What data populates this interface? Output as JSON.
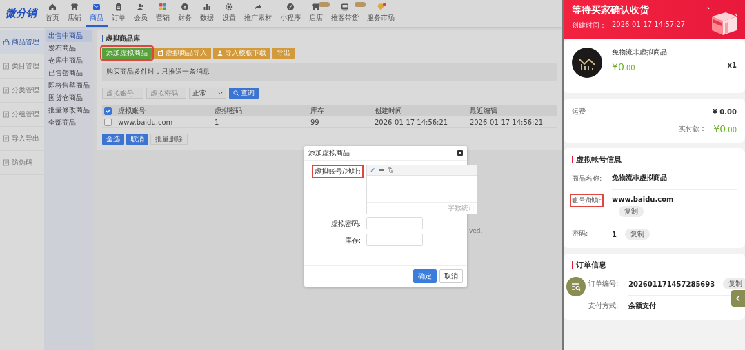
{
  "top_nav": {
    "logo": "微分销",
    "items": [
      {
        "label": "首页",
        "selected": false,
        "badge": false,
        "alert": false
      },
      {
        "label": "店铺",
        "selected": false,
        "badge": false,
        "alert": false
      },
      {
        "label": "商品",
        "selected": true,
        "badge": false,
        "alert": false
      },
      {
        "label": "订单",
        "selected": false,
        "badge": false,
        "alert": false
      },
      {
        "label": "会员",
        "selected": false,
        "badge": false,
        "alert": false
      },
      {
        "label": "营销",
        "selected": false,
        "badge": false,
        "alert": false
      },
      {
        "label": "财务",
        "selected": false,
        "badge": false,
        "alert": false
      },
      {
        "label": "数据",
        "selected": false,
        "badge": false,
        "alert": false
      },
      {
        "label": "设置",
        "selected": false,
        "badge": false,
        "alert": false
      },
      {
        "label": "推广素材",
        "selected": false,
        "badge": false,
        "alert": false
      },
      {
        "label": "小程序",
        "selected": false,
        "badge": false,
        "alert": false
      },
      {
        "label": "启店",
        "selected": false,
        "badge": true,
        "alert": false
      },
      {
        "label": "推客带货",
        "selected": false,
        "badge": true,
        "alert": false
      },
      {
        "label": "服务市场",
        "selected": false,
        "badge": false,
        "alert": true
      }
    ]
  },
  "main_menu": [
    {
      "label": "商品管理",
      "selected": true
    },
    {
      "label": "类目管理",
      "selected": false
    },
    {
      "label": "分类管理",
      "selected": false
    },
    {
      "label": "分组管理",
      "selected": false
    },
    {
      "label": "导入导出",
      "selected": false
    },
    {
      "label": "防伪码",
      "selected": false
    }
  ],
  "sub_menu": [
    {
      "label": "出售中商品",
      "selected": true
    },
    {
      "label": "发布商品",
      "selected": false
    },
    {
      "label": "仓库中商品",
      "selected": false
    },
    {
      "label": "已售罄商品",
      "selected": false
    },
    {
      "label": "即将售罄商品",
      "selected": false
    },
    {
      "label": "囤货仓商品",
      "selected": false
    },
    {
      "label": "批量修改商品",
      "selected": false
    },
    {
      "label": "全部商品",
      "selected": false
    }
  ],
  "panel": {
    "title": "虚拟商品库",
    "actions": [
      {
        "label": "添加虚拟商品",
        "kind": "primary",
        "highlighted": true
      },
      {
        "label": "虚拟商品导入",
        "kind": "import",
        "highlighted": false
      },
      {
        "label": "导入模板下载",
        "kind": "download",
        "highlighted": false
      },
      {
        "label": "导出",
        "kind": "plain",
        "highlighted": false
      }
    ],
    "notice": "购买商品多件时，只推送一条消息",
    "filters": {
      "account_placeholder": "虚拟账号",
      "password_placeholder": "虚拟密码",
      "status": "正常",
      "search_button": "查询"
    },
    "table": {
      "all_checked": true,
      "columns": [
        "虚拟账号",
        "虚拟密码",
        "库存",
        "创建时间",
        "最近编辑"
      ],
      "rows": [
        {
          "checked": false,
          "cells": [
            "www.baidu.com",
            "1",
            "99",
            "2026-01-17 14:56:21",
            "2026-01-17 14:56:21"
          ]
        }
      ]
    },
    "bulk_actions": [
      {
        "label": "全选",
        "primary": true
      },
      {
        "label": "取消",
        "primary": true
      },
      {
        "label": "批量删除",
        "primary": false
      }
    ],
    "footer_fragment": "ved."
  },
  "dialog": {
    "title": "添加虚拟商品",
    "fields": [
      {
        "label": "虚拟账号/地址:",
        "kind": "editor",
        "highlighted": true,
        "counter": "字数统计"
      },
      {
        "label": "虚拟密码:",
        "kind": "input",
        "highlighted": false
      },
      {
        "label": "库存:",
        "kind": "input",
        "highlighted": false
      }
    ],
    "buttons": [
      {
        "label": "确定",
        "primary": true
      },
      {
        "label": "取消",
        "primary": false
      }
    ]
  },
  "order_panel": {
    "status_title": "等待买家确认收货",
    "created_label": "创建时间：",
    "created_time": "2026-01-17 14:57:27",
    "product": {
      "name": "免物流非虚拟商品",
      "price": "¥0.00",
      "quantity": "x1"
    },
    "fees": {
      "shipping_label": "运费",
      "shipping": "¥ 0.00",
      "paid_label": "实付款：",
      "paid": "¥0.00"
    },
    "virtual_info": {
      "title": "虚拟帐号信息",
      "rows": [
        {
          "label": "商品名称:",
          "value": "免物流非虚拟商品",
          "kind": "text",
          "highlighted": false
        },
        {
          "label": "账号/地址",
          "value": "www.baidu.com",
          "kind": "copy_below",
          "copy": "复制",
          "highlighted": true
        },
        {
          "label": "密码:",
          "value": "1",
          "kind": "copy_inline",
          "copy": "复制",
          "highlighted": false
        }
      ]
    },
    "order_info": {
      "title": "订单信息",
      "rows": [
        {
          "label": "订单编号:",
          "value": "202601171457285693",
          "kind": "copy_inline",
          "copy": "复制",
          "highlighted": false
        },
        {
          "label": "支付方式:",
          "value": "余额支付",
          "kind": "text",
          "highlighted": false
        }
      ]
    }
  }
}
